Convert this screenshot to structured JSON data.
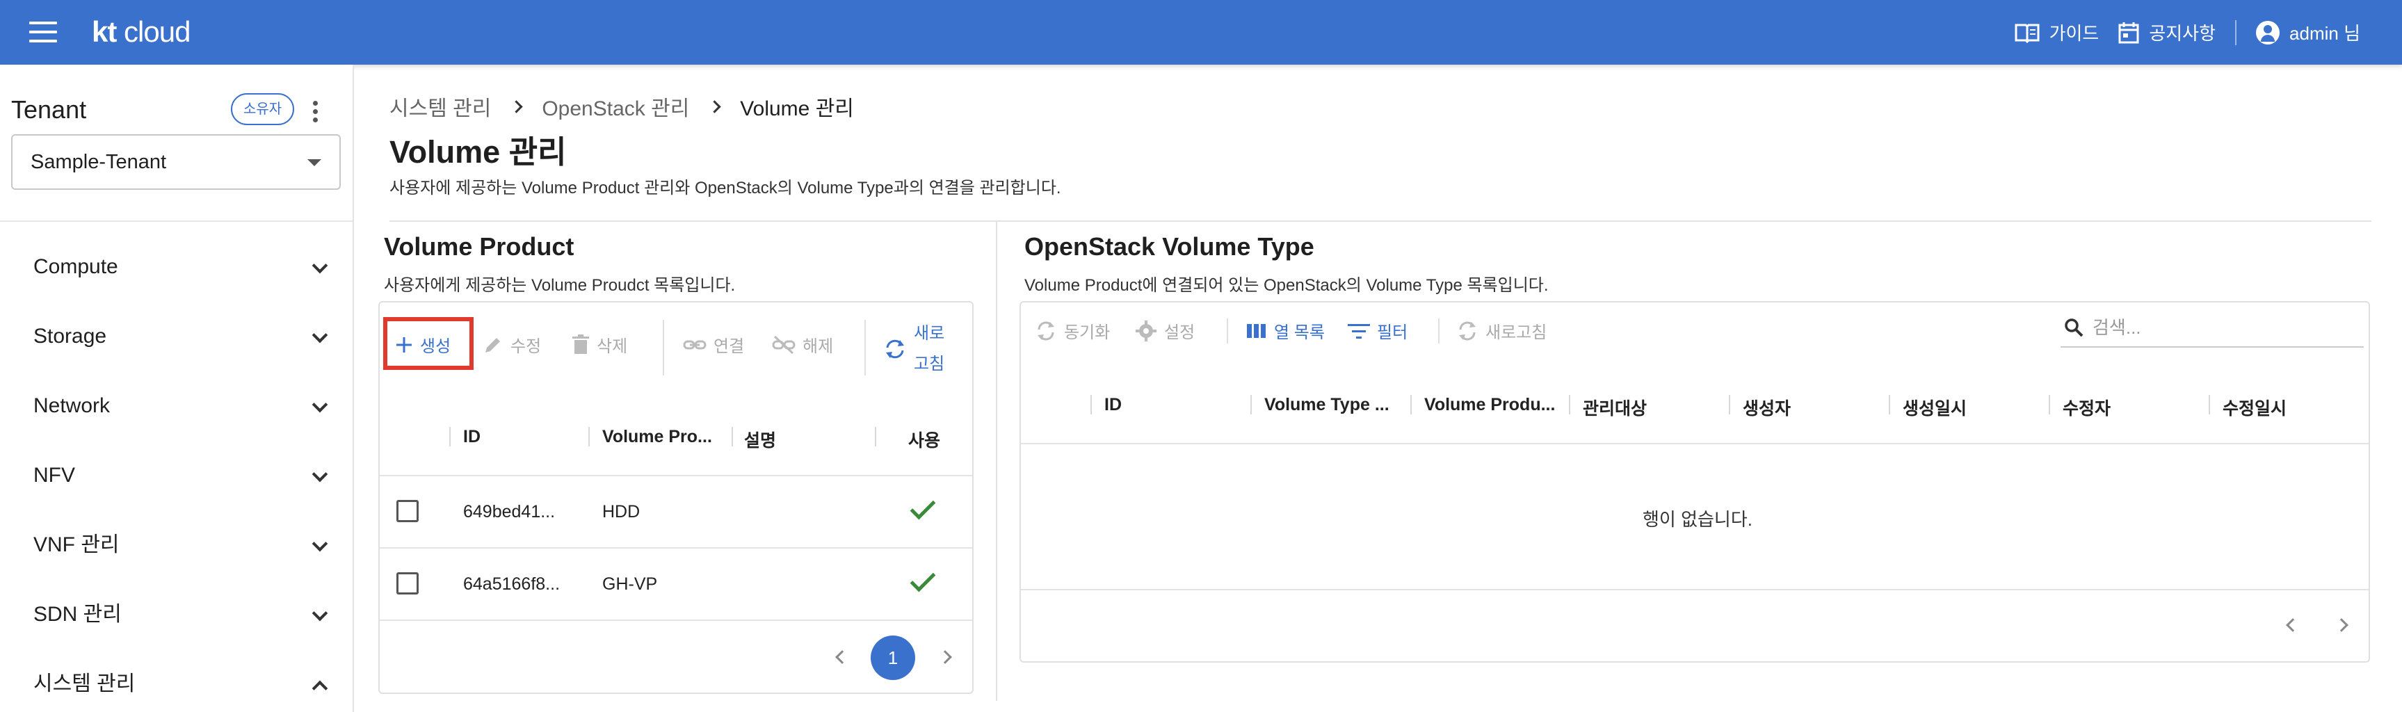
{
  "header": {
    "logo_kt": "kt",
    "logo_cloud": "cloud",
    "guide": "가이드",
    "notice": "공지사항",
    "user": "admin 님"
  },
  "sidebar": {
    "tenant_title": "Tenant",
    "owner_badge": "소유자",
    "tenant_selected": "Sample-Tenant",
    "items": [
      {
        "label": "Compute",
        "expanded": false
      },
      {
        "label": "Storage",
        "expanded": false
      },
      {
        "label": "Network",
        "expanded": false
      },
      {
        "label": "NFV",
        "expanded": false
      },
      {
        "label": "VNF 관리",
        "expanded": false
      },
      {
        "label": "SDN 관리",
        "expanded": false
      },
      {
        "label": "시스템 관리",
        "expanded": true
      }
    ]
  },
  "breadcrumb": [
    "시스템 관리",
    "OpenStack 관리",
    "Volume 관리"
  ],
  "page": {
    "title": "Volume 관리",
    "description": "사용자에 제공하는 Volume Product 관리와 OpenStack의 Volume Type과의 연결을 관리합니다."
  },
  "volume_product": {
    "title": "Volume Product",
    "description": "사용자에게 제공하는 Volume Proudct 목록입니다.",
    "toolbar": {
      "create": "생성",
      "edit": "수정",
      "delete": "삭제",
      "link": "연결",
      "unlink": "해제",
      "refresh_line1": "새로",
      "refresh_line2": "고침"
    },
    "columns": [
      "ID",
      "Volume Pro...",
      "설명",
      "사용"
    ],
    "rows": [
      {
        "id": "649bed41...",
        "name": "HDD",
        "desc": "",
        "enabled": true
      },
      {
        "id": "64a5166f8...",
        "name": "GH-VP",
        "desc": "",
        "enabled": true
      }
    ],
    "current_page": "1"
  },
  "openstack_volume_type": {
    "title": "OpenStack Volume Type",
    "description": "Volume Product에 연결되어 있는 OpenStack의 Volume Type 목록입니다.",
    "toolbar": {
      "sync": "동기화",
      "settings": "설정",
      "columns": "열 목록",
      "filter": "필터",
      "refresh": "새로고침"
    },
    "search_placeholder": "검색...",
    "columns": [
      "ID",
      "Volume Type ...",
      "Volume Produ...",
      "관리대상",
      "생성자",
      "생성일시",
      "수정자",
      "수정일시"
    ],
    "empty_message": "행이 없습니다."
  },
  "colors": {
    "brand": "#3a71cc",
    "highlight": "#e03a2f",
    "check": "#3a8a3a"
  }
}
